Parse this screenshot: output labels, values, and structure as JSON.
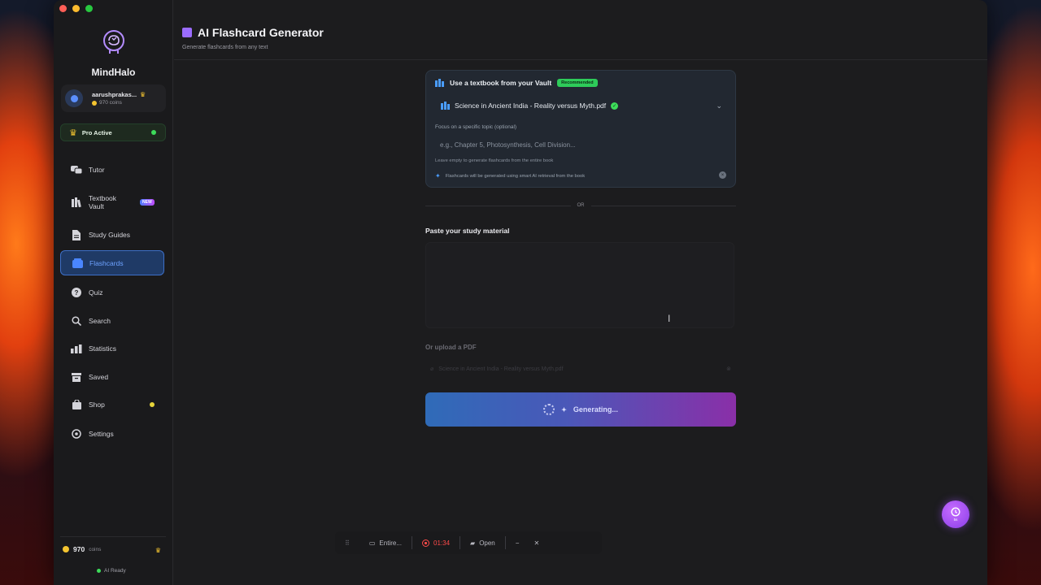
{
  "app": {
    "name": "MindHalo"
  },
  "user": {
    "name": "aarushprakas...",
    "coins": "970 coins"
  },
  "pro": {
    "label": "Pro Active"
  },
  "nav": [
    {
      "label": "Tutor",
      "icon": "chat-icon"
    },
    {
      "label": "Textbook Vault",
      "icon": "books-icon",
      "badge": "NEW"
    },
    {
      "label": "Study Guides",
      "icon": "document-icon"
    },
    {
      "label": "Flashcards",
      "icon": "flashcards-icon",
      "active": true
    },
    {
      "label": "Quiz",
      "icon": "question-icon"
    },
    {
      "label": "Search",
      "icon": "search-icon"
    },
    {
      "label": "Statistics",
      "icon": "bar-chart-icon"
    },
    {
      "label": "Saved",
      "icon": "archive-icon"
    },
    {
      "label": "Shop",
      "icon": "bag-icon"
    },
    {
      "label": "Settings",
      "icon": "gear-icon"
    }
  ],
  "sidebar_footer": {
    "coins_value": "970",
    "coins_unit": "coins",
    "status": "AI Ready"
  },
  "header": {
    "title": "AI Flashcard Generator",
    "subtitle": "Generate flashcards from any text"
  },
  "vault": {
    "title": "Use a textbook from your Vault",
    "badge": "Recommended",
    "selected_book": "Science in Ancient India - Reality versus Myth.pdf",
    "focus_label": "Focus on a specific topic (optional)",
    "focus_placeholder": "e.g., Chapter 5, Photosynthesis, Cell Division...",
    "focus_value": "",
    "hint": "Leave empty to generate flashcards from the entire book",
    "note": "Flashcards will be generated using smart AI retrieval from the book"
  },
  "divider": "OR",
  "paste": {
    "label": "Paste your study material",
    "value": ""
  },
  "upload": {
    "label": "Or upload a PDF",
    "filename": "Science in Ancient India - Reality versus Myth.pdf"
  },
  "generate": {
    "label": "Generating..."
  },
  "recorder": {
    "source": "Entire...",
    "time": "01:34",
    "open": "Open"
  },
  "fab": {
    "label": "5s"
  },
  "colors": {
    "accent": "#3d6fc7",
    "brand_purple": "#9b6cff",
    "success": "#3ddc5a",
    "coin": "#f4c430"
  }
}
